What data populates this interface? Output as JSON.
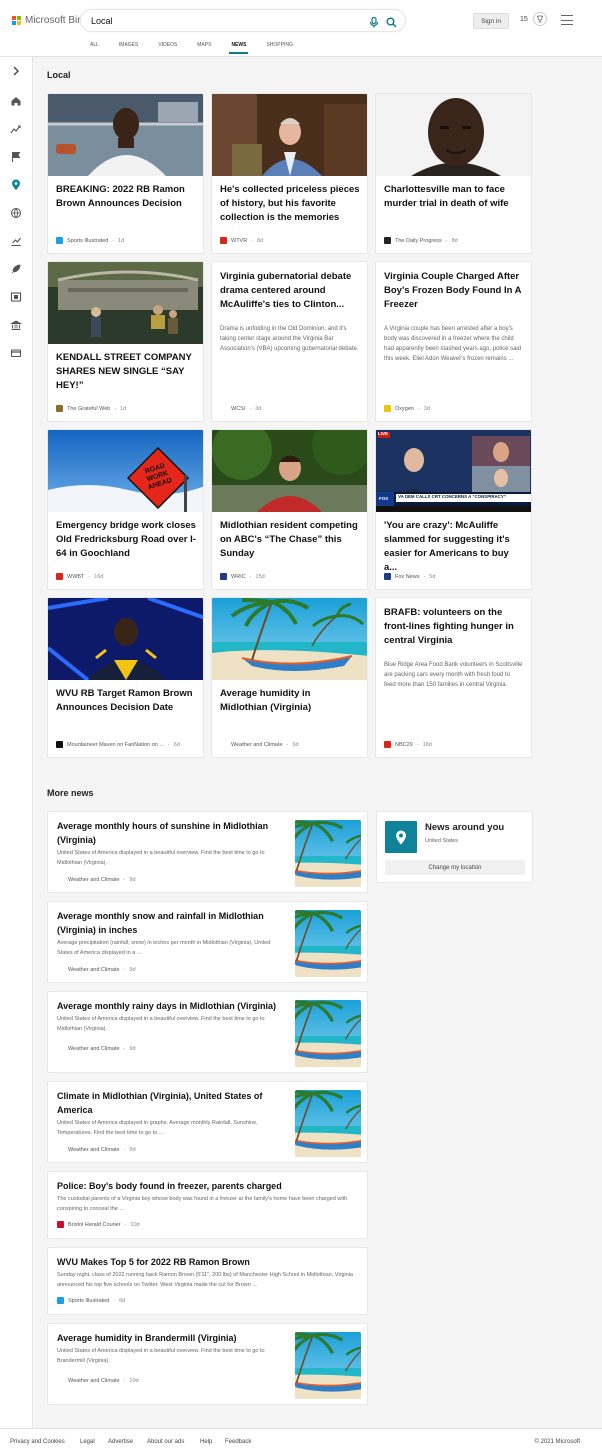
{
  "header": {
    "brand": "Microsoft Bing",
    "query": "Local",
    "sign_in": "Sign in",
    "rewards": "15"
  },
  "scopes": [
    "ALL",
    "IMAGES",
    "VIDEOS",
    "MAPS",
    "NEWS",
    "SHOPPING"
  ],
  "active_scope": "NEWS",
  "rail_icons": [
    "expand-icon",
    "home-icon",
    "trend-icon",
    "flag-icon",
    "location-icon",
    "globe-icon",
    "chart-icon",
    "rocket-icon",
    "film-icon",
    "building-icon",
    "card-icon"
  ],
  "local": {
    "heading": "Local",
    "cards": [
      {
        "title": "BREAKING: 2022 RB Ramon Brown Announces Decision",
        "source": "Sports Illustrated",
        "age": "1d",
        "fav": "#1aa0e8"
      },
      {
        "title": "He's collected priceless pieces of history, but his favorite collection is the memories",
        "source": "WTVR",
        "age": "8d",
        "fav": "#d9261c"
      },
      {
        "title": "Charlottesville man to face murder trial in death of wife",
        "source": "The Daily Progress",
        "age": "8d",
        "fav": "#222"
      },
      {
        "title": "KENDALL STREET COMPANY SHARES NEW SINGLE “SAY HEY!”",
        "source": "The Grateful Web",
        "age": "1d",
        "fav": "#8a6d2f"
      },
      {
        "title": "Virginia gubernatorial debate drama centered around McAuliffe's ties to Clinton...",
        "desc": "Drama is unfolding in the Old Dominion, and it's taking center stage around the Virginia Bar Association's (VBA) upcoming gubernatorial debate.",
        "source": "WCSI",
        "age": "3d",
        "fav": ""
      },
      {
        "title": "Virginia Couple Charged After Boy's Frozen Body Found In A Freezer",
        "desc": "A Virginia couple has been arrested after a boy's body was discovered in a freezer where the child had apparently been stashed years ago, police said this week.  Eliel Adon Weaver's frozen remains ...",
        "source": "Oxygen",
        "age": "3d",
        "fav": "#e8c800"
      },
      {
        "title": "Emergency bridge work closes Old Fredricksburg Road over I-64 in Goochland",
        "source": "WWBT",
        "age": "16d",
        "fav": "#d9261c"
      },
      {
        "title": "Midlothian resident competing on ABC's “The Chase” this Sunday",
        "source": "WRIC",
        "age": "15d",
        "fav": "#1f3c88"
      },
      {
        "title": "'You are crazy': McAuliffe slammed for suggesting it's easier for Americans to buy a...",
        "source": "Fox News",
        "age": "5d",
        "fav": "#1f3c88"
      },
      {
        "title": "WVU RB Target Ramon Brown Announces Decision Date",
        "source": "Mountaineer Maven on FanNation on ...",
        "age": "6d",
        "fav": "#111"
      },
      {
        "title": "Average humidity in Midlothian (Virginia)",
        "source": "Weather and Climate",
        "age": "9d",
        "fav": ""
      },
      {
        "title": "BRAFB: volunteers on the front-lines fighting hunger in central Virginia",
        "desc": "Blue Ridge Area Food Bank volunteers in Scottsville are packing cars every month with fresh food to feed more than 150 families in central Virginia.",
        "source": "NBC29",
        "age": "18d",
        "fav": "#d9261c"
      }
    ],
    "overlays": {
      "sign_text": "ROAD WORK AHEAD",
      "tv_live": "LIVE",
      "tv_banner": "VA DEM CALLS CRT CONCERNS A “CONSPIRACY”",
      "tv_channel": "FOX"
    }
  },
  "more": {
    "heading": "More news",
    "items": [
      {
        "title": "Average monthly hours of sunshine in Midlothian (Virginia)",
        "desc": "United States of America displayed in a beautiful overview. Find the best time to go to Midlothian (Virginia).",
        "source": "Weather and Climate",
        "age": "9d",
        "fav": ""
      },
      {
        "title": "Average monthly snow and rainfall in Midlothian (Virginia) in inches",
        "desc": "Average precipitation (rainfall, snow) in inches per month in Midlothian (Virginia), United States of America displayed in a ...",
        "source": "Weather and Climate",
        "age": "9d",
        "fav": ""
      },
      {
        "title": "Average monthly rainy days in Midlothian (Virginia)",
        "desc": "United States of America displayed in a beautiful overview. Find the best time to go to Midlothian (Virginia).",
        "source": "Weather and Climate",
        "age": "9d",
        "fav": ""
      },
      {
        "title": "Climate in Midlothian (Virginia), United States of America",
        "desc": "United States of America displayed in graphs. Average monthly Rainfall, Sunshine, Temperatures. Find the best time to go to ...",
        "source": "Weather and Climate",
        "age": "9d",
        "fav": ""
      },
      {
        "title": "Police: Boy's body found in freezer, parents charged",
        "desc": "The custodial parents of a Virginia boy whose body was found in a freezer at the family's home have been charged with conspiring to conceal the ...",
        "source": "Bristol Herald Courier",
        "age": "10d",
        "fav": "#c8102e"
      },
      {
        "title": "WVU Makes Top 5 for 2022 RB Ramon Brown",
        "desc": "Sunday night, class of 2022 running back Ramon Brown (5'11\", 200 lbs) of Manchester High School in Midlothian, Virginia announced his top five schools on Twitter. West Virginia made the cut for Brown ...",
        "source": "Sports Illustrated",
        "age": "6d",
        "fav": "#1aa0e8"
      },
      {
        "title": "Average humidity in Brandermill (Virginia)",
        "desc": "United States of America displayed in a beautiful overview. Find the best time to go to Brandermill (Virginia).",
        "source": "Weather and Climate",
        "age": "10d",
        "fav": ""
      }
    ]
  },
  "news_around": {
    "title": "News around you",
    "subtitle": "United States",
    "button": "Change my location"
  },
  "footer": {
    "links": [
      "Privacy and Cookies",
      "Legal",
      "Advertise",
      "About our ads",
      "Help",
      "Feedback"
    ],
    "copyright": "© 2021 Microsoft"
  },
  "colors": {
    "accent": "#0f7a8a",
    "search_icon": "#0f7a8a",
    "location_tile": "#10829a"
  }
}
